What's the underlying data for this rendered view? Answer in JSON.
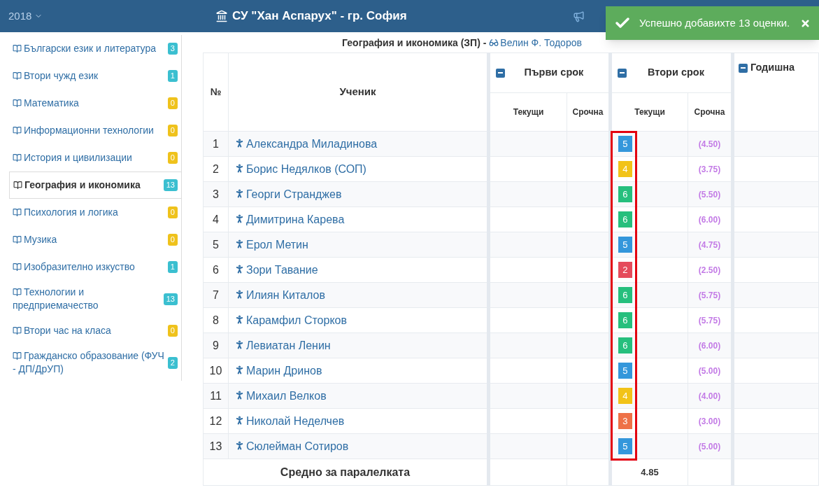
{
  "header": {
    "year": "2018",
    "school": "СУ \"Хан Аспарух\" - гр. София"
  },
  "toast": {
    "message": "Успешно добавихте 13 оценки."
  },
  "sidebar": {
    "items": [
      {
        "label": "Български език и литература",
        "count": "3",
        "color": "#3bbfd0",
        "selected": false
      },
      {
        "label": "Втори чужд език",
        "count": "1",
        "color": "#3bbfd0",
        "selected": false
      },
      {
        "label": "Математика",
        "count": "0",
        "color": "#efc21c",
        "selected": false
      },
      {
        "label": "Информационни технологии",
        "count": "0",
        "color": "#efc21c",
        "selected": false
      },
      {
        "label": "История и цивилизации",
        "count": "0",
        "color": "#efc21c",
        "selected": false
      },
      {
        "label": "География и икономика",
        "count": "13",
        "color": "#3bbfd0",
        "selected": true
      },
      {
        "label": "Психология и логика",
        "count": "0",
        "color": "#efc21c",
        "selected": false
      },
      {
        "label": "Музика",
        "count": "0",
        "color": "#efc21c",
        "selected": false
      },
      {
        "label": "Изобразително изкуство",
        "count": "1",
        "color": "#3bbfd0",
        "selected": false
      },
      {
        "label": "Технологии и предприемачество",
        "count": "13",
        "color": "#3bbfd0",
        "selected": false
      },
      {
        "label": "Втори час на класа",
        "count": "0",
        "color": "#efc21c",
        "selected": false
      },
      {
        "label": "Гражданско образование (ФУЧ - ДП/ДрУП)",
        "count": "2",
        "color": "#3bbfd0",
        "selected": false
      }
    ]
  },
  "table": {
    "subject": "География и икономика (ЗП)",
    "separator": "-",
    "teacher": "Велин Ф. Тодоров",
    "columns": {
      "number": "№",
      "student": "Ученик",
      "terms": [
        {
          "title": "Първи срок",
          "current": "Текущи",
          "term_grade": "Срочна"
        },
        {
          "title": "Втори срок",
          "current": "Текущи",
          "term_grade": "Срочна"
        }
      ],
      "annual": "Годишна"
    },
    "rows": [
      {
        "number": "1",
        "name": "Александра Миладинова",
        "grade": "5",
        "color": "#3497db",
        "average": "(4.50)"
      },
      {
        "number": "2",
        "name": "Борис Недялков (СОП)",
        "grade": "4",
        "color": "#f2c318",
        "average": "(3.75)"
      },
      {
        "number": "3",
        "name": "Георги Странджев",
        "grade": "6",
        "color": "#26bf7d",
        "average": "(5.50)"
      },
      {
        "number": "4",
        "name": "Димитрина Карева",
        "grade": "6",
        "color": "#26bf7d",
        "average": "(6.00)"
      },
      {
        "number": "5",
        "name": "Ерол Метин",
        "grade": "5",
        "color": "#3497db",
        "average": "(4.75)"
      },
      {
        "number": "6",
        "name": "Зори Тавание",
        "grade": "2",
        "color": "#e54b5b",
        "average": "(2.50)"
      },
      {
        "number": "7",
        "name": "Илиян Киталов",
        "grade": "6",
        "color": "#26bf7d",
        "average": "(5.75)"
      },
      {
        "number": "8",
        "name": "Карамфил Сторков",
        "grade": "6",
        "color": "#26bf7d",
        "average": "(5.75)"
      },
      {
        "number": "9",
        "name": "Левиатан Ленин",
        "grade": "6",
        "color": "#26bf7d",
        "average": "(6.00)"
      },
      {
        "number": "10",
        "name": "Марин Дринов",
        "grade": "5",
        "color": "#3497db",
        "average": "(5.00)"
      },
      {
        "number": "11",
        "name": "Михаил Велков",
        "grade": "4",
        "color": "#f2c318",
        "average": "(4.00)"
      },
      {
        "number": "12",
        "name": "Николай Неделчев",
        "grade": "3",
        "color": "#ee7147",
        "average": "(3.00)"
      },
      {
        "number": "13",
        "name": "Сюлейман Сотиров",
        "grade": "5",
        "color": "#3497db",
        "average": "(5.00)"
      }
    ],
    "footer": {
      "label": "Средно за паралелката",
      "average": "4.85"
    }
  }
}
